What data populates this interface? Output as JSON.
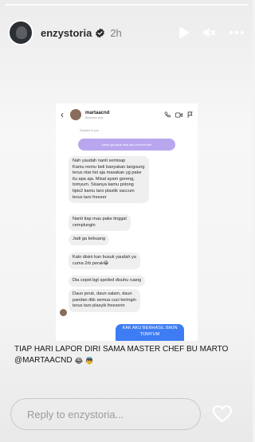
{
  "story": {
    "progress_fraction": 1.0,
    "user": {
      "username": "enzystoria",
      "verified": true,
      "time": "2h"
    },
    "header_icons": [
      "play-icon",
      "mute-icon",
      "more-icon"
    ]
  },
  "dm": {
    "name": "martaacnd",
    "subtitle": "Business chat",
    "replied_label": "Replied to you",
    "purple_msg": "Kamu ga pakai akal aku cuma ini kali",
    "messages": [
      "Nah yaudah nanti semisap\nKamu nemu beli banyakan langsung\nterus ntar list aja masakan yg pake\nitu apa aja. Misal ayam goreng,\ntomyum. Sisanya kamu potong\ntipis2 kamu taro plastik vaccum\nterus taro freezer",
      "Nanti tiap mau pake tinggal\ncemplungin",
      "Jadi ga kebuang",
      "Kalo disini kan busuk yaudah ya\ncuma 2rb perak😂",
      "Dia cepet bgt spoiled disuhu ruang",
      "Daun jeruk, daun salam, daun\npandan dkk semua cuci keringin\nterus taro plasyik freezerin"
    ],
    "sent_msg": "KAK AKU BERHASIL BIKIN\nTOMYUM"
  },
  "caption": {
    "line1": "TIAP HARI LAPOR DIRI SAMA MASTER CHEF BU MARTO",
    "line2": "@MARTAACND",
    "emojis": "😂 👼"
  },
  "reply": {
    "placeholder": "Reply to enzystoria..."
  },
  "colors": {
    "purple": "#b8a7ee",
    "blue": "#3d7cf3",
    "verified": "#3897f0"
  }
}
